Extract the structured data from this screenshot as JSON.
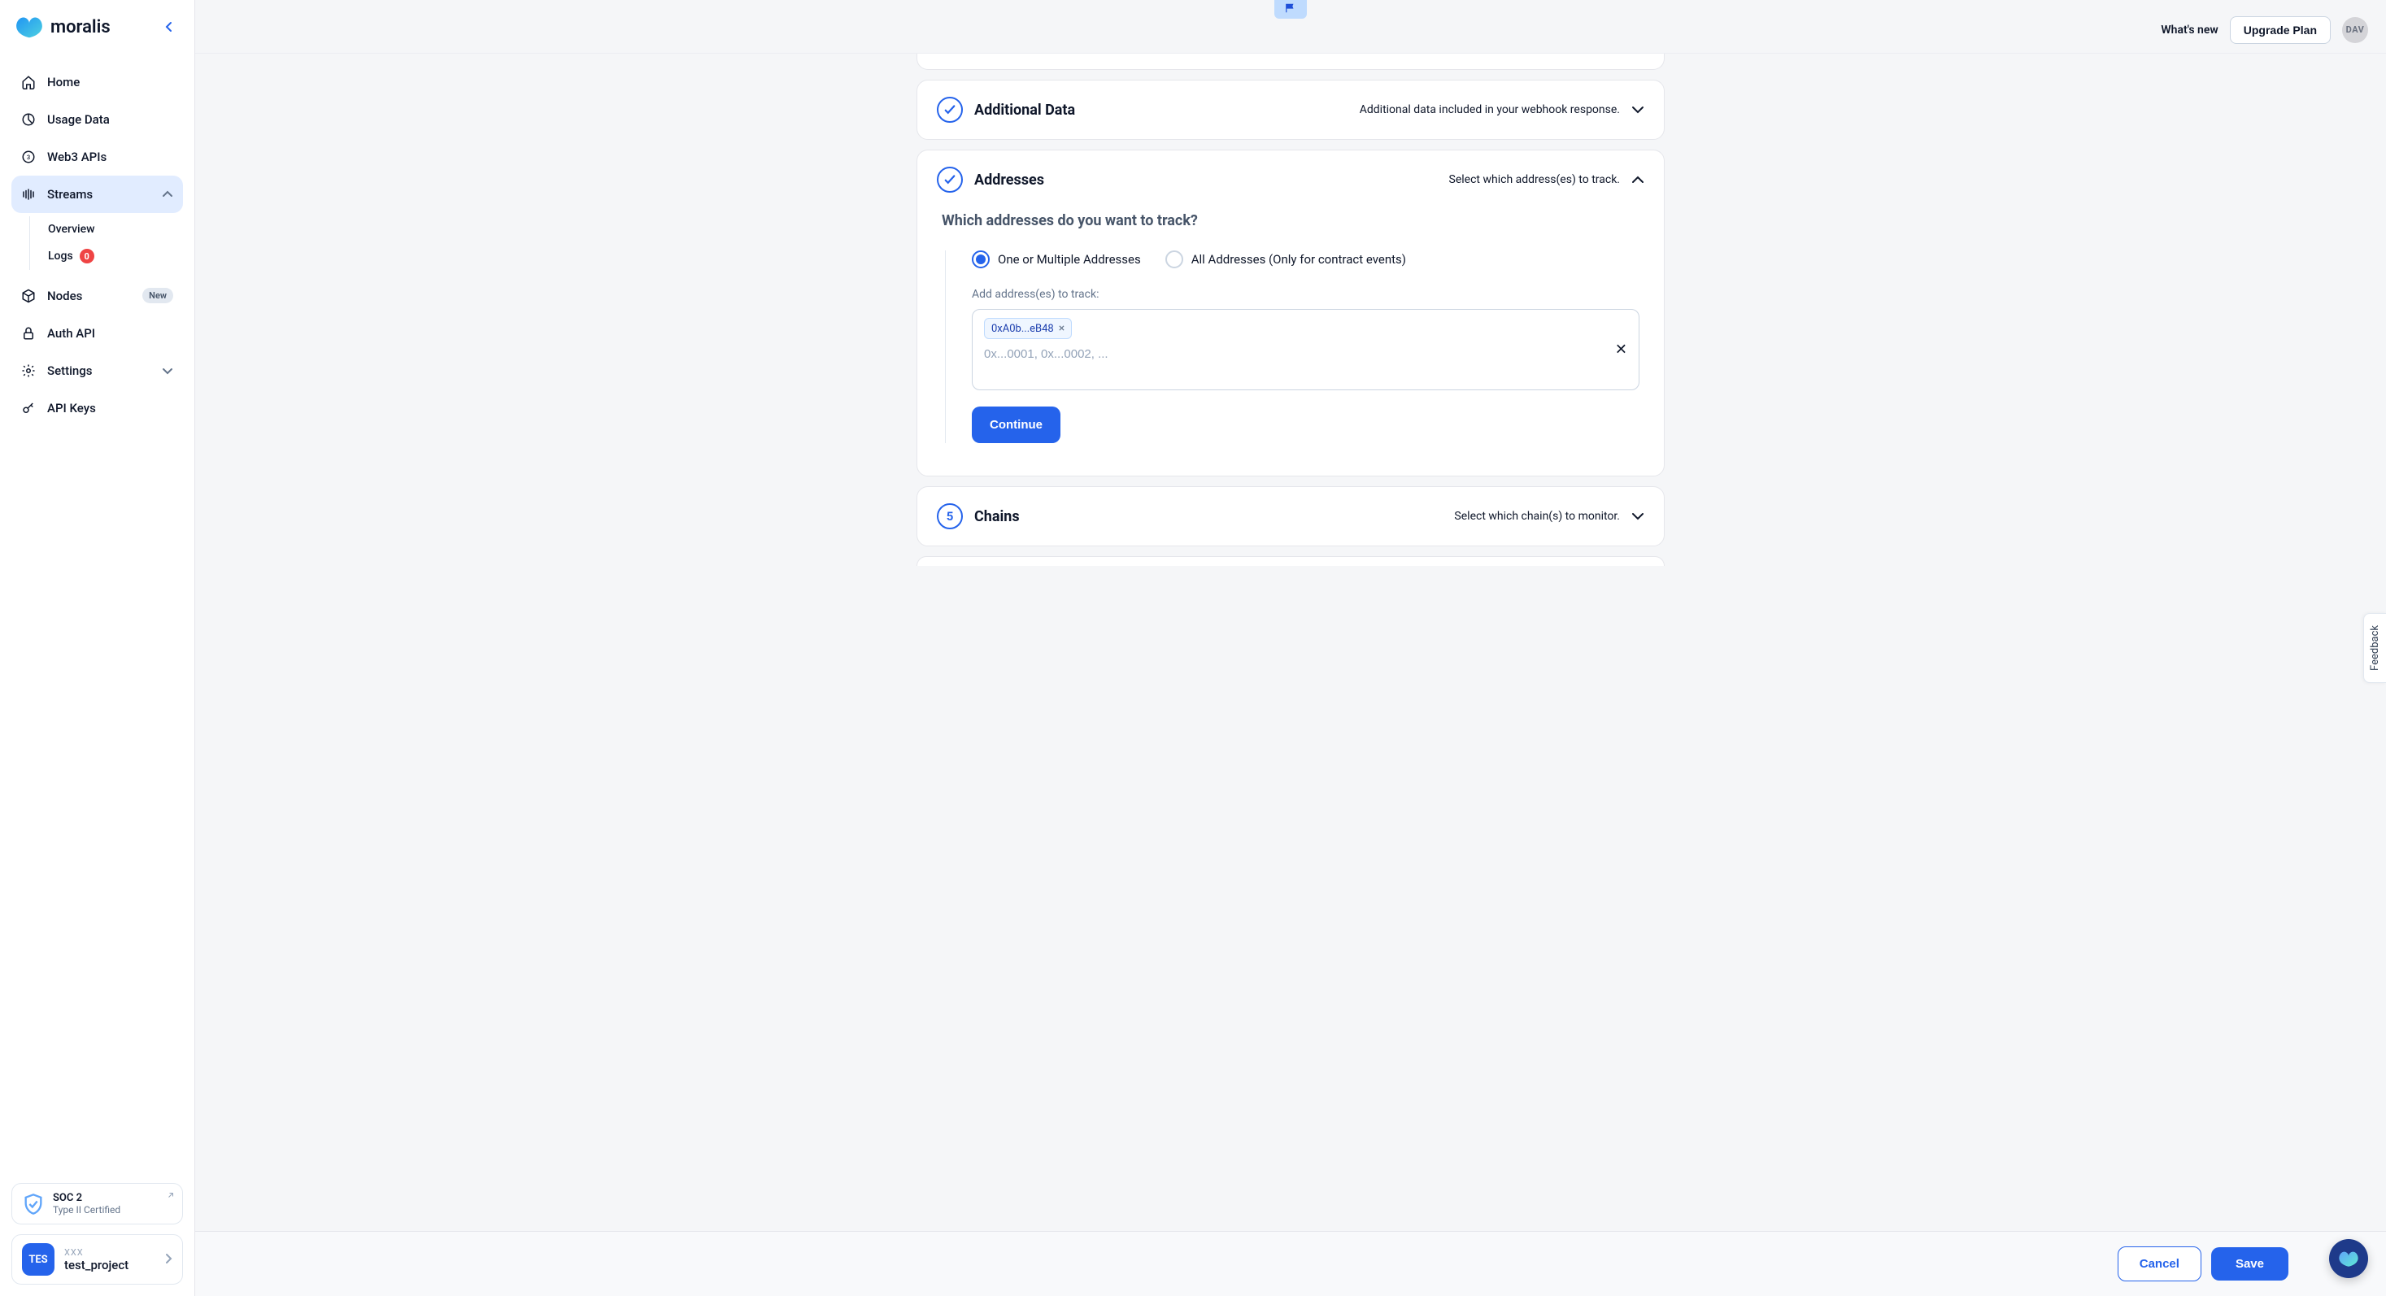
{
  "brand": "moralis",
  "topbar": {
    "whats_new": "What's new",
    "upgrade": "Upgrade Plan",
    "avatar_initials": "DAV"
  },
  "sidebar": {
    "items": {
      "home": "Home",
      "usage": "Usage Data",
      "web3": "Web3 APIs",
      "streams": "Streams",
      "nodes": "Nodes",
      "nodes_badge": "New",
      "auth": "Auth API",
      "settings": "Settings",
      "apikeys": "API Keys"
    },
    "streams_sub": {
      "overview": "Overview",
      "logs": "Logs",
      "logs_count": "0"
    },
    "soc": {
      "line1": "SOC 2",
      "line2": "Type II Certified"
    },
    "project": {
      "badge": "TES",
      "eyebrow": "XXX",
      "name": "test_project"
    }
  },
  "sections": {
    "additional_data": {
      "title": "Additional Data",
      "subtitle": "Additional data included in your webhook response."
    },
    "addresses": {
      "title": "Addresses",
      "subtitle": "Select which address(es) to track.",
      "question": "Which addresses do you want to track?",
      "opt1": "One or Multiple Addresses",
      "opt2": "All Addresses (Only for contract events)",
      "field_label": "Add address(es) to track:",
      "chip_value": "0xA0b...eB48",
      "placeholder": "0x...0001, 0x...0002, ...",
      "continue": "Continue"
    },
    "chains": {
      "number": "5",
      "title": "Chains",
      "subtitle": "Select which chain(s) to monitor."
    }
  },
  "footer": {
    "cancel": "Cancel",
    "save": "Save"
  },
  "feedback": "Feedback"
}
